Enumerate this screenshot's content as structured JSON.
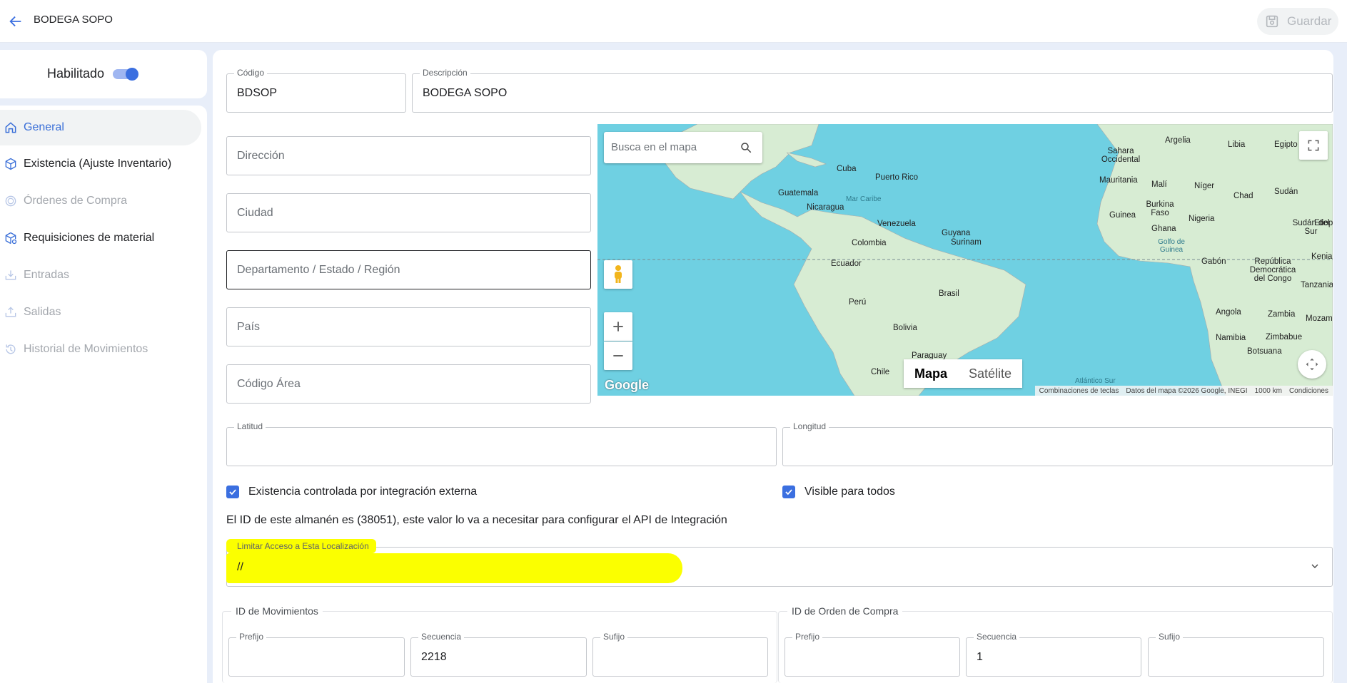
{
  "header": {
    "back_label": "",
    "title": "BODEGA SOPO",
    "save_label": "Guardar"
  },
  "sidebar": {
    "enabled_label": "Habilitado",
    "enabled": true,
    "items": [
      {
        "label": "General",
        "icon": "home-icon",
        "state": "active"
      },
      {
        "label": "Existencia (Ajuste Inventario)",
        "icon": "box-icon",
        "state": "normal"
      },
      {
        "label": "Órdenes de Compra",
        "icon": "coin-icon",
        "state": "disabled"
      },
      {
        "label": "Requisiciones de material",
        "icon": "box-settings-icon",
        "state": "normal"
      },
      {
        "label": "Entradas",
        "icon": "inbox-in-icon",
        "state": "disabled"
      },
      {
        "label": "Salidas",
        "icon": "outbox-icon",
        "state": "disabled"
      },
      {
        "label": "Historial de Movimientos",
        "icon": "history-icon",
        "state": "disabled"
      }
    ]
  },
  "form": {
    "codigo": {
      "label": "Código",
      "value": "BDSOP"
    },
    "descripcion": {
      "label": "Descripción",
      "value": "BODEGA SOPO"
    },
    "direccion": {
      "placeholder": "Dirección"
    },
    "ciudad": {
      "placeholder": "Ciudad"
    },
    "departamento": {
      "placeholder": "Departamento / Estado / Región"
    },
    "pais": {
      "placeholder": "País"
    },
    "codigo_area": {
      "placeholder": "Código Área"
    },
    "latitud": {
      "label": "Latitud",
      "value": ""
    },
    "longitud": {
      "label": "Longitud",
      "value": ""
    },
    "existencia_externa": {
      "label": "Existencia controlada por integración externa",
      "checked": true
    },
    "visible_todos": {
      "label": "Visible para todos",
      "checked": true
    },
    "info_text": "El ID de este almanén es (38051), este valor lo va a necesitar para configurar el API de Integración",
    "limitar_acceso": {
      "label": "Limitar Acceso a Esta Localización",
      "value": "//"
    },
    "id_movimientos": {
      "title": "ID de Movimientos",
      "prefijo": {
        "label": "Prefijo",
        "value": ""
      },
      "secuencia": {
        "label": "Secuencia",
        "value": "2218"
      },
      "sufijo": {
        "label": "Sufijo",
        "value": ""
      }
    },
    "id_orden_compra": {
      "title": "ID de Orden de Compra",
      "prefijo": {
        "label": "Prefijo",
        "value": ""
      },
      "secuencia": {
        "label": "Secuencia",
        "value": "1"
      },
      "sufijo": {
        "label": "Sufijo",
        "value": ""
      }
    }
  },
  "map": {
    "search_placeholder": "Busca en el mapa",
    "type_map": "Mapa",
    "type_satellite": "Satélite",
    "google": "Google",
    "footer": [
      "Combinaciones de teclas",
      "Datos del mapa ©2026 Google, INEGI",
      "1000 km",
      "Condiciones"
    ],
    "labels": {
      "cuba": "Cuba",
      "puerto_rico": "Puerto Rico",
      "guatemala": "Guatemala",
      "nicaragua": "Nicaragua",
      "mar_caribe": "Mar Caribe",
      "venezuela": "Venezuela",
      "guyana": "Guyana",
      "surinam": "Surinam",
      "colombia": "Colombia",
      "ecuador": "Ecuador",
      "peru": "Perú",
      "brasil": "Brasil",
      "bolivia": "Bolivia",
      "paraguay": "Paraguay",
      "chile": "Chile",
      "atlantico_sur": "Atlántico Sur",
      "sahara": "Sahara Occidental",
      "argelia": "Argelia",
      "libia": "Libia",
      "egipto": "Egipto",
      "mauritania": "Mauritania",
      "mali": "Malí",
      "niger": "Níger",
      "chad": "Chad",
      "sudan": "Sudán",
      "burkina": "Burkina Faso",
      "guinea": "Guinea",
      "ghana": "Ghana",
      "nigeria": "Nigeria",
      "golfo_guinea": "Golfo de Guinea",
      "sudan_sur": "Sudán del Sur",
      "etiopia": "Etiop",
      "gabon": "Gabón",
      "rdc": "República Democrática del Congo",
      "kenia": "Kenia",
      "tanzania": "Tanzania",
      "angola": "Angola",
      "zambia": "Zambia",
      "mozambique": "Mozam",
      "namibia": "Namibia",
      "zimbabue": "Zimbabue",
      "botsuana": "Botsuana"
    }
  },
  "colors": {
    "accent": "#3b6fe0",
    "highlight": "#fbff00",
    "map_water": "#6fd0e2",
    "map_land": "#d7ecd3"
  }
}
